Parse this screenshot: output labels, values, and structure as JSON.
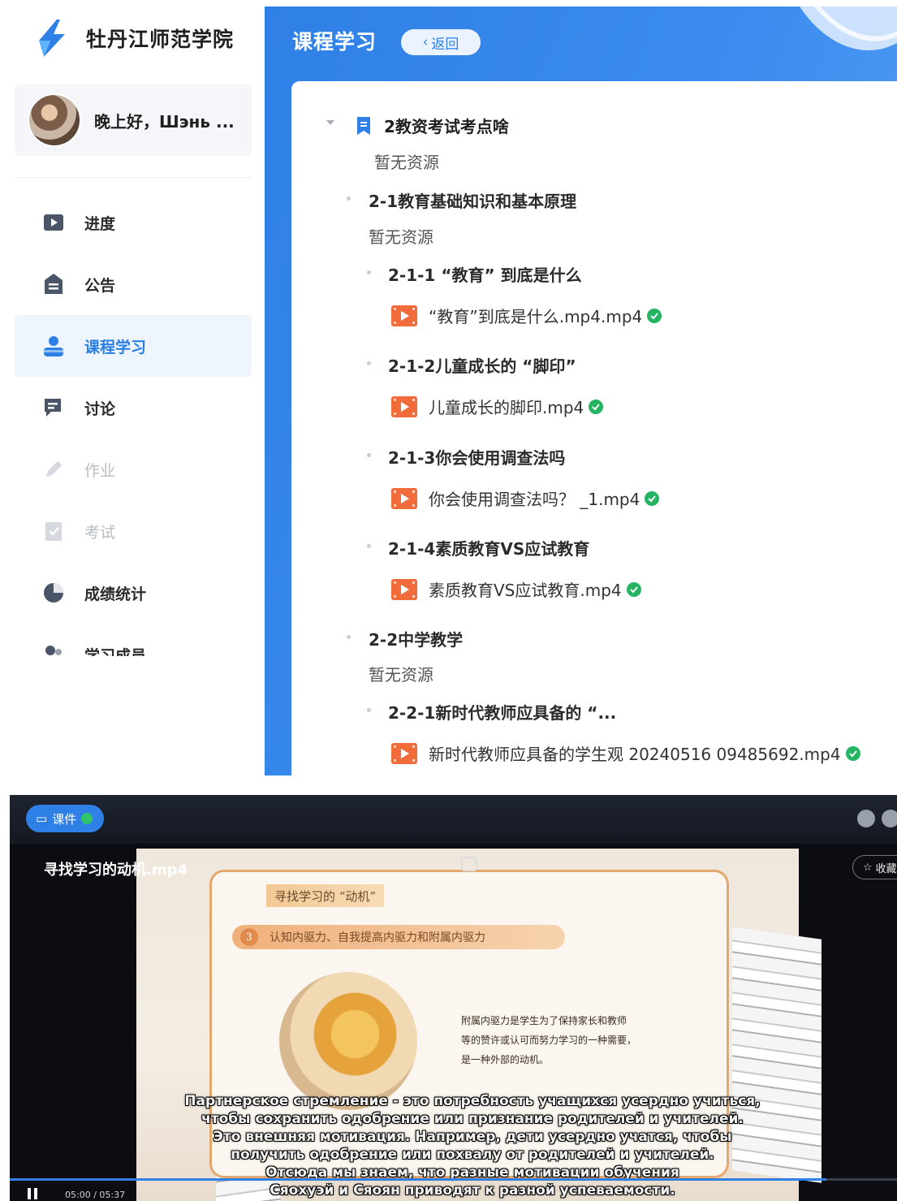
{
  "sidebar": {
    "school_name": "牡丹江师范学院",
    "greeting": "晚上好，Шэнь ...",
    "menu": [
      {
        "label": "进度",
        "icon": "flag-icon",
        "state": "normal"
      },
      {
        "label": "公告",
        "icon": "notice-icon",
        "state": "normal"
      },
      {
        "label": "课程学习",
        "icon": "course-icon",
        "state": "active"
      },
      {
        "label": "讨论",
        "icon": "chat-icon",
        "state": "normal"
      },
      {
        "label": "作业",
        "icon": "pencil-icon",
        "state": "disabled"
      },
      {
        "label": "考试",
        "icon": "exam-icon",
        "state": "disabled"
      },
      {
        "label": "成绩统计",
        "icon": "pie-chart-icon",
        "state": "normal"
      },
      {
        "label": "学习成员",
        "icon": "members-icon",
        "state": "normal"
      }
    ]
  },
  "header": {
    "title": "课程学习",
    "back_label": "返回"
  },
  "tree": {
    "chapter_title": "2教资考试考点啥",
    "chapter_empty": "暂无资源",
    "sec1_title": "2-1教育基础知识和基本原理",
    "sec1_empty": "暂无资源",
    "sec1_1_title": "2-1-1 “教育” 到底是什么",
    "sec1_1_file": "“教育”到底是什么.mp4.mp4",
    "sec1_2_title": "2-1-2儿童成长的 “脚印”",
    "sec1_2_file": "儿童成长的脚印.mp4",
    "sec1_3_title": "2-1-3你会使用调查法吗",
    "sec1_3_file": "你会使用调查法吗？ _1.mp4",
    "sec1_4_title": "2-1-4素质教育VS应试教育",
    "sec1_4_file": "素质教育VS应试教育.mp4",
    "sec2_title": "2-2中学教学",
    "sec2_empty": "暂无资源",
    "sec2_1_title": "2-2-1新时代教师应具备的 “...",
    "sec2_1_file": "新时代教师应具备的学生观  20240516  09485692.mp4"
  },
  "player": {
    "courseware_label": "课件",
    "video_title": "寻找学习的动机.mp4",
    "favorite_label": "收藏",
    "slide_heading": "寻找学习的 “动机”",
    "slide_num": "3",
    "slide_subtitle": "认知内驱力、自我提高内驱力和附属内驱力",
    "slide_text_1": "附属内驱力是学生为了保持家长和教师",
    "slide_text_2": "等的赞许或认可而努力学习的一种需要，",
    "slide_text_3": "是一种外部的动机。",
    "subtitle_1": "Партнерское стремление - это потребность учащихся усердно учиться,",
    "subtitle_2": "чтобы сохранить одобрение или признание родителей и учителей.",
    "subtitle_3": "Это внешняя мотивация. Например, дети усердно учатся, чтобы",
    "subtitle_4": "получить одобрение или похвалу от родителей и учителей.",
    "subtitle_5": "Отсюда мы знаем, что разные мотивации обучения",
    "subtitle_6": "Сяохуэй и Сяоян приводят к разной успеваемости.",
    "time_display": "05:00 / 05:37",
    "progress_fraction": 0.92
  },
  "colors": {
    "accent": "#2f80e6",
    "check_green": "#25b562",
    "video_icon": "#f26b3a"
  }
}
